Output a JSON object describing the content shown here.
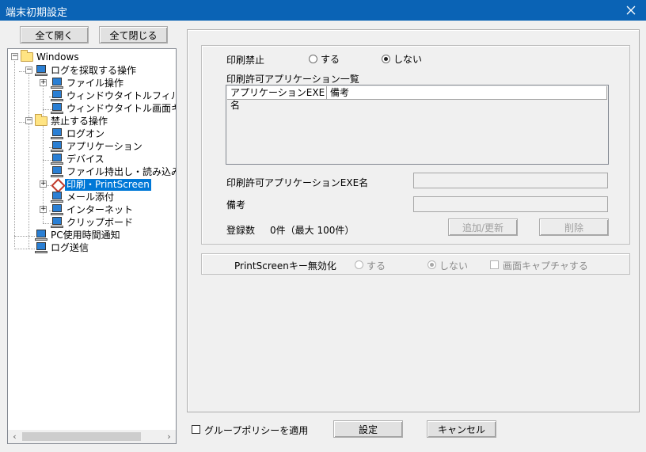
{
  "window": {
    "title": "端末初期設定",
    "close_icon": "close-icon"
  },
  "sidebar": {
    "expand_all": "全て開く",
    "collapse_all": "全て閉じる",
    "tree": {
      "root": "Windows",
      "log_ops": "ログを採取する操作",
      "file_ops": "ファイル操作",
      "window_title_filter": "ウィンドウタイトルフィルタ",
      "window_title_capture": "ウィンドウタイトル画面キャ",
      "prohibit_ops": "禁止する操作",
      "logon": "ログオン",
      "application": "アプリケーション",
      "device": "デバイス",
      "file_transfer": "ファイル持出し・読み込み",
      "print_screen": "印刷・PrintScreen",
      "mail_attach": "メール添付",
      "internet": "インターネット",
      "clipboard": "クリップボード",
      "pc_usage": "PC使用時間通知",
      "log_send": "ログ送信"
    }
  },
  "print": {
    "prohibit_label": "印刷禁止",
    "opt_yes": "する",
    "opt_no": "しない",
    "allowed_list_label": "印刷許可アプリケーション一覧",
    "col_exe": "アプリケーションEXE名",
    "col_note": "備考",
    "exe_label": "印刷許可アプリケーションEXE名",
    "note_label": "備考",
    "count_label": "登録数",
    "count_value": "0件（最大 100件）",
    "add_update": "追加/更新",
    "delete": "削除"
  },
  "printscreen": {
    "label": "PrintScreenキー無効化",
    "opt_yes": "する",
    "opt_no": "しない",
    "capture_label": "画面キャプチャする"
  },
  "footer": {
    "group_policy": "グループポリシーを適用",
    "ok": "設定",
    "cancel": "キャンセル"
  }
}
